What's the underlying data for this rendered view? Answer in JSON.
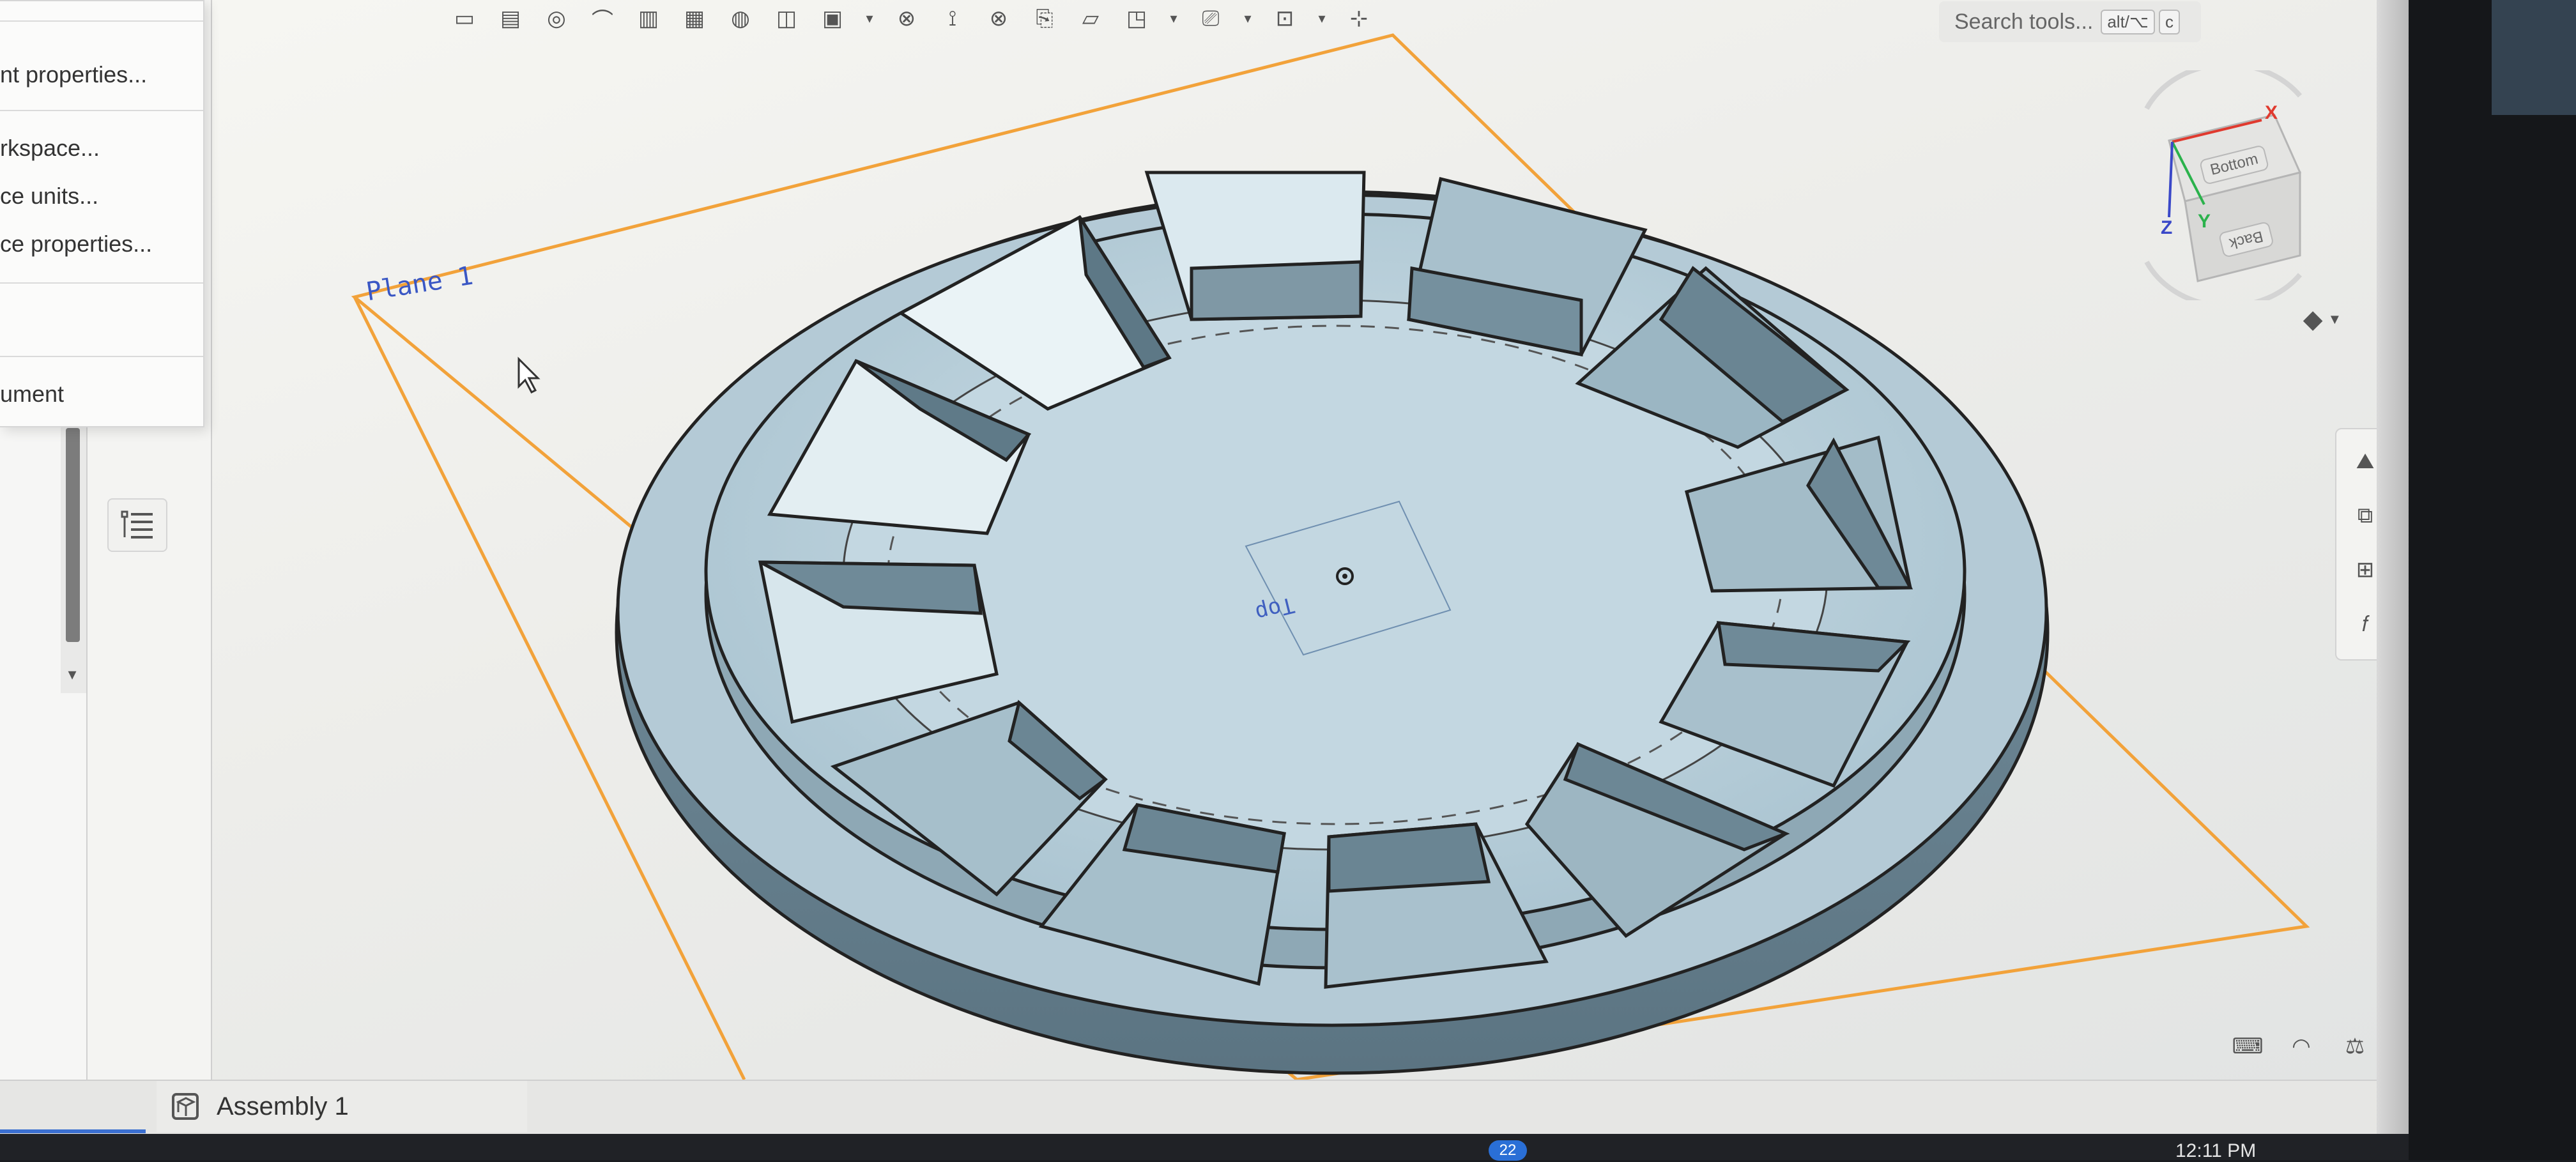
{
  "menu": {
    "items": [
      {
        "label": "nt properties..."
      },
      {
        "label": "rkspace..."
      },
      {
        "label": "ce units..."
      },
      {
        "label": "ce properties..."
      },
      {
        "label": "ument"
      }
    ]
  },
  "viewport": {
    "plane_label": "Plane 1",
    "top_label": "Top"
  },
  "search": {
    "placeholder": "Search tools...",
    "shortcut_modifier": "alt/⌥",
    "shortcut_key": "c"
  },
  "view_cube": {
    "axis_x": "X",
    "axis_y": "Y",
    "axis_z": "Z",
    "face_top": "Bottom",
    "face_side": "Back"
  },
  "tabs": {
    "assembly_label": "Assembly 1"
  },
  "taskbar": {
    "clock": "12:11 PM",
    "badge": "22"
  },
  "colors": {
    "model": "#b9cfdb",
    "plane_outline": "#f2a23a",
    "accent": "#3b6fd0"
  },
  "icons": {
    "toolbar": [
      "sketch-icon",
      "extrude-icon",
      "revolve-icon",
      "sweep-icon",
      "fillet-icon",
      "chamfer-icon",
      "shell-icon",
      "boolean-icon",
      "pattern-icon",
      "mirror-icon",
      "transform-icon",
      "plane-icon",
      "mate-icon",
      "measure-icon",
      "add-icon"
    ]
  }
}
